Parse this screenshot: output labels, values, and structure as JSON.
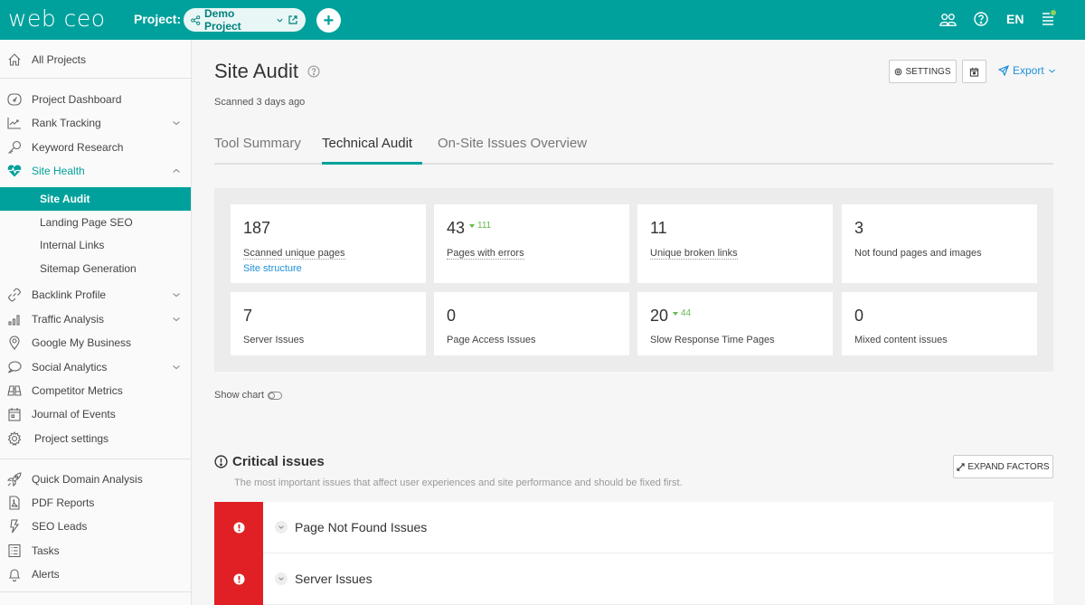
{
  "topbar": {
    "logo": "web ceo",
    "project_label": "Project:",
    "project_name": "Demo Project",
    "language": "EN",
    "icons": [
      "users-icon",
      "help-icon",
      "menu-icon"
    ]
  },
  "sidebar": {
    "all_projects": "All Projects",
    "items": [
      {
        "label": "Project Dashboard",
        "icon": "dashboard-icon"
      },
      {
        "label": "Rank Tracking",
        "icon": "chart-line-icon",
        "expandable": true
      },
      {
        "label": "Keyword Research",
        "icon": "key-icon"
      },
      {
        "label": "Site Health",
        "icon": "heart-pulse-icon",
        "expandable": true,
        "expanded": true
      }
    ],
    "site_health_sub": [
      {
        "label": "Site Audit",
        "active": true
      },
      {
        "label": "Landing Page SEO"
      },
      {
        "label": "Internal Links"
      },
      {
        "label": "Sitemap Generation"
      }
    ],
    "items2": [
      {
        "label": "Backlink Profile",
        "icon": "link-icon",
        "expandable": true
      },
      {
        "label": "Traffic Analysis",
        "icon": "bar-chart-icon",
        "expandable": true
      },
      {
        "label": "Google My Business",
        "icon": "map-pin-icon"
      },
      {
        "label": "Social Analytics",
        "icon": "chat-bubble-icon",
        "expandable": true
      },
      {
        "label": "Competitor Metrics",
        "icon": "binoculars-icon"
      },
      {
        "label": "Journal of Events",
        "icon": "calendar-icon"
      },
      {
        "label": "Project settings",
        "icon": "gear-icon"
      }
    ],
    "tools": [
      {
        "label": "Quick Domain Analysis",
        "icon": "rocket-icon"
      },
      {
        "label": "PDF Reports",
        "icon": "pdf-icon"
      },
      {
        "label": "SEO Leads",
        "icon": "lightning-icon"
      },
      {
        "label": "Tasks",
        "icon": "tasks-icon"
      },
      {
        "label": "Alerts",
        "icon": "bell-icon"
      }
    ]
  },
  "main": {
    "title": "Site Audit",
    "scanned": "Scanned 3 days ago",
    "settings_label": "SETTINGS",
    "export_label": "Export",
    "tabs": [
      {
        "label": "Tool Summary",
        "active": false
      },
      {
        "label": "Technical Audit",
        "active": true
      },
      {
        "label": "On-Site Issues Overview",
        "active": false
      }
    ],
    "stats": [
      {
        "value": "187",
        "label": "Scanned unique pages",
        "link": "Site structure",
        "dotted": true
      },
      {
        "value": "43",
        "delta": "111",
        "label": "Pages with errors",
        "dotted": true
      },
      {
        "value": "11",
        "label": "Unique broken links",
        "dotted": true
      },
      {
        "value": "3",
        "label": "Not found pages and images"
      },
      {
        "value": "7",
        "label": "Server Issues"
      },
      {
        "value": "0",
        "label": "Page Access Issues"
      },
      {
        "value": "20",
        "delta": "44",
        "label": "Slow Response Time Pages"
      },
      {
        "value": "0",
        "label": "Mixed content issues"
      }
    ],
    "show_chart_label": "Show chart",
    "show_chart_enabled": false,
    "critical": {
      "title": "Critical issues",
      "description": "The most important issues that affect user experiences and site performance and should be fixed first.",
      "expand_label": "EXPAND FACTORS",
      "issues": [
        {
          "title": "Page Not Found Issues"
        },
        {
          "title": "Server Issues"
        }
      ]
    }
  },
  "colors": {
    "brand": "#00a19c",
    "link": "#1e90d8",
    "critical": "#e02025",
    "positive_delta": "#62b94e"
  }
}
